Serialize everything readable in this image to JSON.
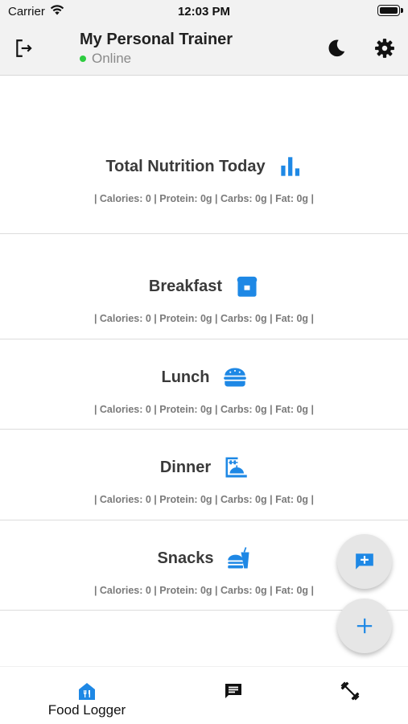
{
  "status_bar": {
    "carrier": "Carrier",
    "time": "12:03 PM"
  },
  "header": {
    "title": "My Personal Trainer",
    "status": "Online",
    "status_color": "#2ecc40"
  },
  "accent_color": "#1e88e5",
  "sections": [
    {
      "title": "Total Nutrition Today",
      "icon": "bar-chart-icon",
      "summary": "| Calories: 0 | Protein: 0g | Carbs: 0g | Fat: 0g |"
    },
    {
      "title": "Breakfast",
      "icon": "bread-icon",
      "summary": "| Calories: 0 | Protein: 0g | Carbs: 0g | Fat: 0g |"
    },
    {
      "title": "Lunch",
      "icon": "burger-icon",
      "summary": "| Calories: 0 | Protein: 0g | Carbs: 0g | Fat: 0g |"
    },
    {
      "title": "Dinner",
      "icon": "room-service-icon",
      "summary": "| Calories: 0 | Protein: 0g | Carbs: 0g | Fat: 0g |"
    },
    {
      "title": "Snacks",
      "icon": "fastfood-icon",
      "summary": "| Calories: 0 | Protein: 0g | Carbs: 0g | Fat: 0g |"
    }
  ],
  "fabs": [
    {
      "icon": "add-comment-icon"
    },
    {
      "icon": "plus-icon"
    }
  ],
  "tab_bar": {
    "items": [
      {
        "label": "Food Logger",
        "icon": "food-logger-icon",
        "active": true
      },
      {
        "label": "",
        "icon": "chat-icon",
        "active": false
      },
      {
        "label": "",
        "icon": "dumbbell-icon",
        "active": false
      }
    ]
  }
}
